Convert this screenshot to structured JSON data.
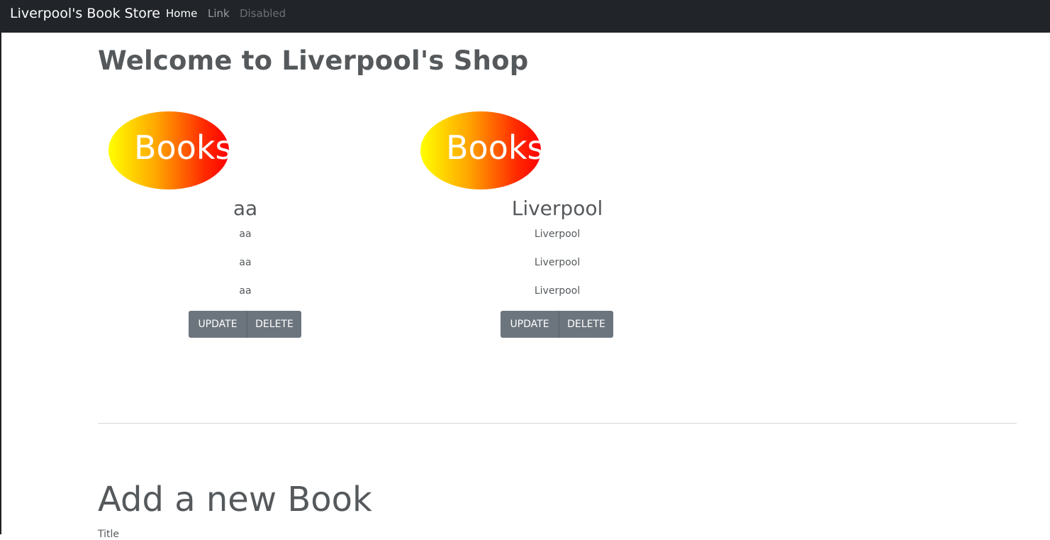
{
  "navbar": {
    "brand": "Liverpool's Book Store",
    "links": [
      "Home",
      "Link",
      "Disabled"
    ]
  },
  "page": {
    "title": "Welcome to Liverpool's Shop"
  },
  "books": [
    {
      "logo_text": "Books",
      "title": "aa",
      "lines": [
        "aa",
        "aa",
        "aa"
      ],
      "update_label": "UPDATE",
      "delete_label": "DELETE"
    },
    {
      "logo_text": "Books",
      "title": "Liverpool",
      "lines": [
        "Liverpool",
        "Liverpool",
        "Liverpool"
      ],
      "update_label": "UPDATE",
      "delete_label": "DELETE"
    }
  ],
  "add_section": {
    "title": "Add a new Book",
    "first_field_label": "Title"
  },
  "colors": {
    "navbar_bg": "#212529",
    "button_bg": "#6c757d",
    "text": "#55595c"
  }
}
